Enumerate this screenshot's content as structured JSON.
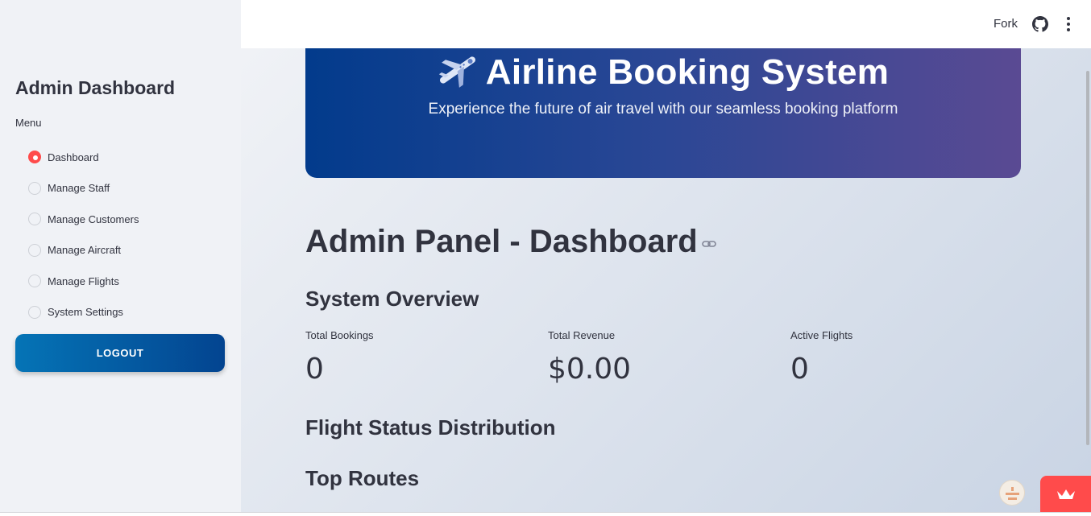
{
  "sidebar": {
    "title": "Admin Dashboard",
    "menu_label": "Menu",
    "items": [
      {
        "label": "Dashboard",
        "selected": true
      },
      {
        "label": "Manage Staff",
        "selected": false
      },
      {
        "label": "Manage Customers",
        "selected": false
      },
      {
        "label": "Manage Aircraft",
        "selected": false
      },
      {
        "label": "Manage Flights",
        "selected": false
      },
      {
        "label": "System Settings",
        "selected": false
      }
    ],
    "logout_label": "LOGOUT"
  },
  "header": {
    "fork_label": "Fork",
    "icons": [
      "github-icon",
      "kebab-menu-icon"
    ]
  },
  "hero": {
    "icon": "airplane-icon",
    "title": "Airline Booking System",
    "subtitle": "Experience the future of air travel with our seamless booking platform"
  },
  "main": {
    "page_title": "Admin Panel - Dashboard",
    "overview_heading": "System Overview",
    "metrics": [
      {
        "label": "Total Bookings",
        "value": "0"
      },
      {
        "label": "Total Revenue",
        "value": "$0.00"
      },
      {
        "label": "Active Flights",
        "value": "0"
      }
    ],
    "status_heading": "Flight Status Distribution",
    "routes_heading": "Top Routes"
  },
  "colors": {
    "accent_red": "#ff4b4b",
    "logout_gradient_start": "#0574b6",
    "logout_gradient_end": "#034490",
    "hero_gradient_start": "#023b8c",
    "hero_gradient_end": "#5a4a93",
    "text": "#31333f",
    "sidebar_bg": "#f0f2f6"
  }
}
